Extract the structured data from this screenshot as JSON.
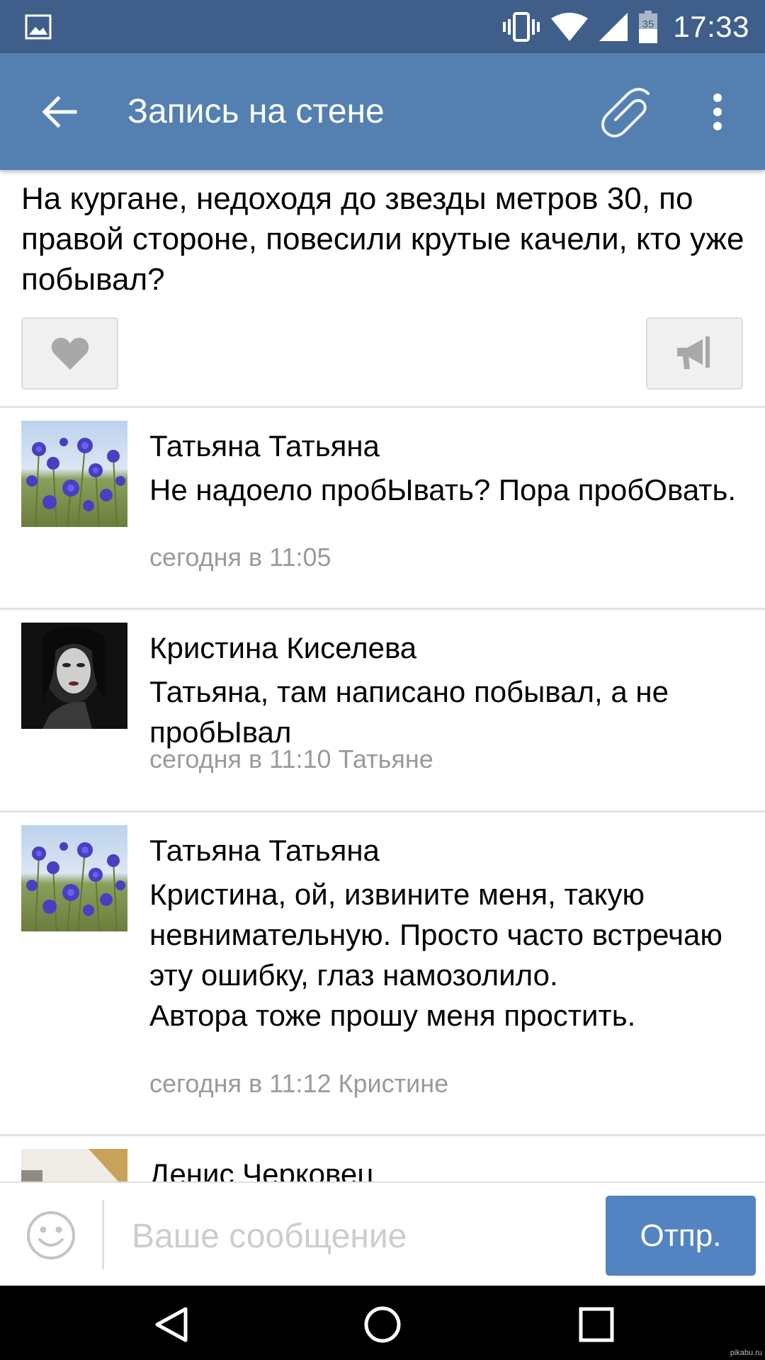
{
  "status_bar": {
    "time": "17:33",
    "battery_level": "35",
    "icons": [
      "gallery-icon",
      "vibrate-icon",
      "wifi-icon",
      "signal-icon",
      "battery-icon"
    ]
  },
  "toolbar": {
    "title": "Запись на стене",
    "icons": [
      "back-arrow-icon",
      "paperclip-icon",
      "more-vert-icon"
    ]
  },
  "post": {
    "text": "На кургане, недоходя до звезды метров 30, по правой стороне, повесили крутые качели, кто уже побывал?",
    "actions": [
      "heart-icon",
      "megaphone-icon"
    ]
  },
  "comments": [
    {
      "author": "Татьяна Татьяна",
      "text": "Не надоело пробЫвать? Пора пробОвать.",
      "meta": "сегодня в 11:05",
      "avatar": "cornflowers"
    },
    {
      "author": "Кристина Киселева",
      "text": "Татьяна, там написано побывал, а не пробЫвал",
      "meta": "сегодня в 11:10 Татьяне",
      "avatar": "dark-portrait"
    },
    {
      "author": "Татьяна Татьяна",
      "text": "Кристина, ой, извините меня, такую невнимательную. Просто часто встречаю эту ошибку, глаз намозолило.\nАвтора тоже прошу меня простить.",
      "meta": "сегодня в 11:12 Кристине",
      "avatar": "cornflowers"
    },
    {
      "author": "Денис Черковец",
      "avatar": "room-photo"
    }
  ],
  "composer": {
    "placeholder": "Ваше сообщение",
    "send_label": "Отпр."
  },
  "nav_bar": {
    "icons": [
      "back-triangle-icon",
      "home-circle-icon",
      "recents-square-icon"
    ]
  },
  "watermark": "pikabu.ru",
  "colors": {
    "status_bar": "#3f5f8a",
    "toolbar": "#5480b1",
    "send_button": "#5383c1",
    "meta_text": "#9a9a9a"
  }
}
